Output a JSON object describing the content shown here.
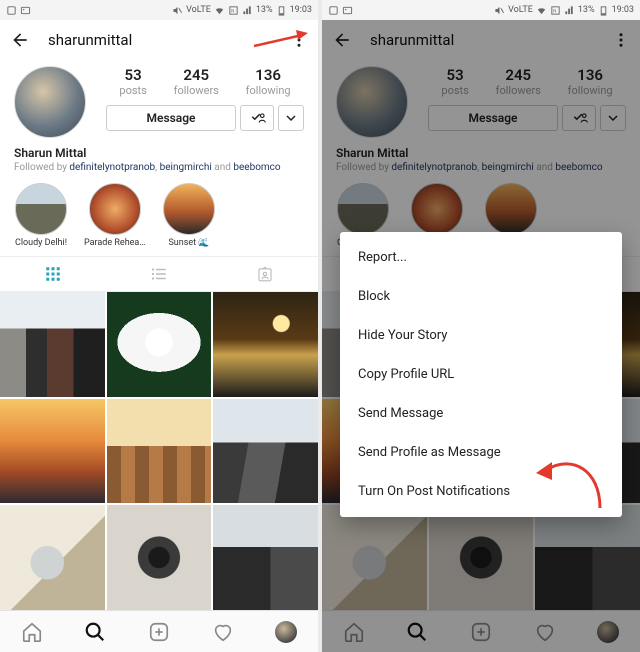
{
  "status": {
    "battery_pct": "13%",
    "time": "19:03"
  },
  "profile": {
    "username": "sharunmittal",
    "display_name": "Sharun Mittal",
    "stats": {
      "posts": {
        "count": "53",
        "label": "posts"
      },
      "followers": {
        "count": "245",
        "label": "followers"
      },
      "following": {
        "count": "136",
        "label": "following"
      }
    },
    "message_button": "Message",
    "followed_by_prefix": "Followed by ",
    "followed_by_links": [
      "definitelynotpranob",
      "beingmirchi",
      "beebomco"
    ],
    "followed_by_joiner": ", ",
    "followed_by_last_joiner": " and "
  },
  "highlights": [
    {
      "label": "Cloudy Delhi!"
    },
    {
      "label": "Parade Rehear..."
    },
    {
      "label": "Sunset 🌊"
    }
  ],
  "menu": {
    "items": [
      "Report...",
      "Block",
      "Hide Your Story",
      "Copy Profile URL",
      "Send Message",
      "Send Profile as Message",
      "Turn On Post Notifications"
    ]
  }
}
